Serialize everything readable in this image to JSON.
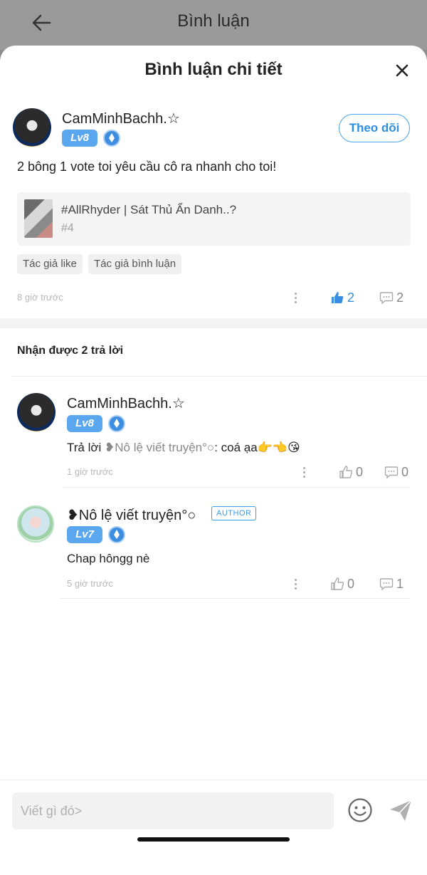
{
  "background": {
    "title": "Bình luận"
  },
  "sheet": {
    "title": "Bình luận chi tiết"
  },
  "main_comment": {
    "username": "CamMinhBachh.☆",
    "level": "Lv8",
    "follow_label": "Theo dõi",
    "text": "2 bông 1 vote toi yêu cầu cô ra nhanh cho toi!",
    "story": {
      "title": "#AllRhyder | Sát Thủ Ẩn Danh..?",
      "chapter": "#4"
    },
    "tags": [
      "Tác giả like",
      "Tác giả bình luận"
    ],
    "time": "8 giờ trước",
    "likes": "2",
    "replies": "2"
  },
  "replies_header": "Nhận được 2 trả lời",
  "replies": [
    {
      "username": "CamMinhBachh.☆",
      "level": "Lv8",
      "prefix": "Trả lời ",
      "mention": "❥Nô lệ viết truyện°○",
      "text": ": coá ạa👉👈😘",
      "time": "1 giờ trước",
      "likes": "0",
      "replies": "0"
    },
    {
      "username": "❥Nô lệ viết truyện°○",
      "author_badge": "AUTHOR",
      "level": "Lv7",
      "text": "Chap hôngg nè",
      "time": "5 giờ trước",
      "likes": "0",
      "replies": "1"
    }
  ],
  "composer": {
    "placeholder": "Viết gì đó>"
  },
  "colors": {
    "accent": "#3b8fe0",
    "level_badge": "#5aa7f0"
  }
}
